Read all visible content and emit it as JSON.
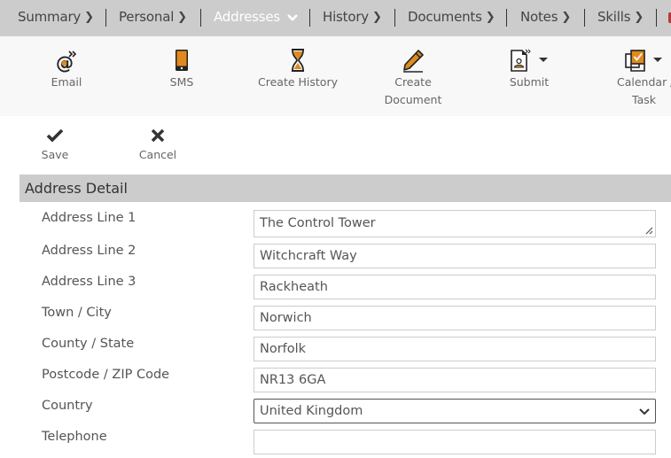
{
  "nav": {
    "items": [
      {
        "label": "Summary",
        "chevron": "chevron-right",
        "active": false
      },
      {
        "label": "Personal",
        "chevron": "chevron-right",
        "active": false
      },
      {
        "label": "Addresses",
        "chevron": "chevron-down",
        "active": true
      },
      {
        "label": "History",
        "chevron": "chevron-right",
        "active": false
      },
      {
        "label": "Documents",
        "chevron": "chevron-right",
        "active": false
      },
      {
        "label": "Notes",
        "chevron": "chevron-right",
        "active": false
      },
      {
        "label": "Skills",
        "chevron": "chevron-right",
        "active": false
      }
    ],
    "chevron_right_glyph": "❯",
    "chevron_down_glyph": "⌄"
  },
  "toolbar": {
    "email_label": "Email",
    "sms_label": "SMS",
    "create_history_label": "Create History",
    "create_document_label_1": "Create",
    "create_document_label_2": "Document",
    "submit_label": "Submit",
    "calendar_label_1": "Calendar /",
    "calendar_label_2": "Task"
  },
  "actions": {
    "save_label": "Save",
    "cancel_label": "Cancel"
  },
  "section": {
    "title": "Address Detail"
  },
  "form": {
    "address_line_1": {
      "label": "Address Line 1",
      "value": "The Control Tower"
    },
    "address_line_2": {
      "label": "Address Line 2",
      "value": "Witchcraft Way"
    },
    "address_line_3": {
      "label": "Address Line 3",
      "value": "Rackheath"
    },
    "town_city": {
      "label": "Town / City",
      "value": "Norwich"
    },
    "county_state": {
      "label": "County / State",
      "value": "Norfolk"
    },
    "postcode": {
      "label": "Postcode / ZIP Code",
      "value": "NR13 6GA"
    },
    "country": {
      "label": "Country",
      "value": "United Kingdom"
    },
    "telephone": {
      "label": "Telephone",
      "value": ""
    }
  },
  "colors": {
    "accent_orange": "#e08a1e",
    "nav_bg": "#cccccc",
    "nav_active_text": "#ffffff",
    "section_header_bg": "#cccccc"
  }
}
